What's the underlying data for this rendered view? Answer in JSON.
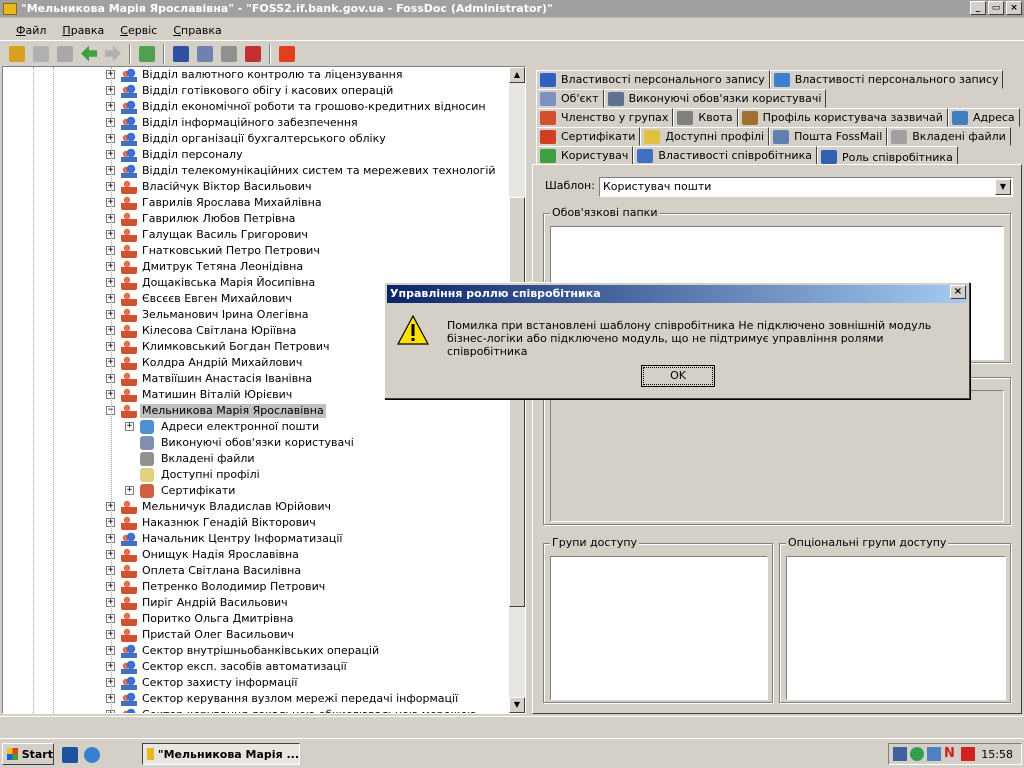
{
  "window": {
    "title": "\"Мельникова Марія Ярославівна\" - \"FOSS2.if.bank.gov.ua - FossDoc (Administrator)\""
  },
  "menu": [
    "Файл",
    "Правка",
    "Сервіс",
    "Справка"
  ],
  "tree": {
    "items": [
      {
        "label": "Відділ валютного контролю та ліцензування",
        "type": "dept",
        "level": 0
      },
      {
        "label": "Відділ готівкового обігу і касових операцій",
        "type": "dept",
        "level": 0
      },
      {
        "label": "Відділ економічної роботи та грошово-кредитних відносин",
        "type": "dept",
        "level": 0
      },
      {
        "label": "Відділ інформаційного забезпечення",
        "type": "dept",
        "level": 0
      },
      {
        "label": "Відділ організації бухгалтерського обліку",
        "type": "dept",
        "level": 0
      },
      {
        "label": "Відділ персоналу",
        "type": "dept",
        "level": 0
      },
      {
        "label": "Відділ телекомунікаційних систем та мережевих технологій",
        "type": "dept",
        "level": 0
      },
      {
        "label": "Власійчук Віктор Васильович",
        "type": "person",
        "level": 0
      },
      {
        "label": "Гаврилів Ярослава Михайлівна",
        "type": "person",
        "level": 0
      },
      {
        "label": "Гаврилюк Любов Петрівна",
        "type": "person",
        "level": 0
      },
      {
        "label": "Галущак Василь Григорович",
        "type": "person",
        "level": 0
      },
      {
        "label": "Гнатковський Петро Петрович",
        "type": "person",
        "level": 0
      },
      {
        "label": "Дмитрук Тетяна Леонідівна",
        "type": "person",
        "level": 0
      },
      {
        "label": "Дощаківська Марія Йосипівна",
        "type": "person",
        "level": 0
      },
      {
        "label": "Євсєєв Евген Михайлович",
        "type": "person",
        "level": 0
      },
      {
        "label": "Зельманович Ірина Олегівна",
        "type": "person",
        "level": 0
      },
      {
        "label": "Кілесова Світлана Юріївна",
        "type": "person",
        "level": 0
      },
      {
        "label": "Климковський Богдан Петрович",
        "type": "person",
        "level": 0
      },
      {
        "label": "Колдра Андрій Михайлович",
        "type": "person",
        "level": 0
      },
      {
        "label": "Матвіїшин Анастасія Іванівна",
        "type": "person",
        "level": 0
      },
      {
        "label": "Матишин Віталій Юрієвич",
        "type": "person",
        "level": 0
      },
      {
        "label": "Мельникова Марія Ярославівна",
        "type": "person",
        "level": 0,
        "expanded": true,
        "selected": true
      },
      {
        "label": "Адреси електронної пошти",
        "type": "mail",
        "level": 1,
        "expandable": true
      },
      {
        "label": "Виконуючі обов'язки користувачі",
        "type": "duty",
        "level": 1
      },
      {
        "label": "Вкладені файли",
        "type": "file",
        "level": 1
      },
      {
        "label": "Доступні профілі",
        "type": "profile",
        "level": 1
      },
      {
        "label": "Сертифікати",
        "type": "cert",
        "level": 1,
        "expandable": true
      },
      {
        "label": "Мельничук Владислав Юрійович",
        "type": "person",
        "level": 0
      },
      {
        "label": "Наказнюк Генадій Вікторович",
        "type": "person",
        "level": 0
      },
      {
        "label": "Начальник Центру Інформатизації",
        "type": "dept",
        "level": 0
      },
      {
        "label": "Онищук Надія Ярославівна",
        "type": "person",
        "level": 0
      },
      {
        "label": "Оплета Світлана Василівна",
        "type": "person",
        "level": 0
      },
      {
        "label": "Петренко Володимир Петрович",
        "type": "person",
        "level": 0
      },
      {
        "label": "Пиріг Андрій Васильович",
        "type": "person",
        "level": 0
      },
      {
        "label": "Поритко Ольга Дмитрівна",
        "type": "person",
        "level": 0
      },
      {
        "label": "Пристай Олег Васильович",
        "type": "person",
        "level": 0
      },
      {
        "label": "Сектор внутрішньобанківських операцій",
        "type": "dept",
        "level": 0
      },
      {
        "label": "Сектор експ. засобів автоматизації",
        "type": "dept",
        "level": 0
      },
      {
        "label": "Сектор захисту інформації",
        "type": "dept",
        "level": 0
      },
      {
        "label": "Сектор керування вузлом мережі передачі інформації",
        "type": "dept",
        "level": 0
      },
      {
        "label": "Сектор керування локальною обчислювальною мережею",
        "type": "dept",
        "level": 0
      }
    ]
  },
  "tabs": {
    "rows": [
      [
        {
          "label": "Властивості персонального запису",
          "icon": "#3060c0"
        },
        {
          "label": "Властивості персонального запису",
          "icon": "#4080d0"
        }
      ],
      [
        {
          "label": "Об'єкт",
          "icon": "#8090c0"
        },
        {
          "label": "Виконуючі обов'язки користувачі",
          "icon": "#607090"
        }
      ],
      [
        {
          "label": "Членство у групах",
          "icon": "#d05030"
        },
        {
          "label": "Квота",
          "icon": "#808080"
        },
        {
          "label": "Профіль користувача зазвичай",
          "icon": "#a07030"
        },
        {
          "label": "Адреса",
          "icon": "#4080c0"
        }
      ],
      [
        {
          "label": "Сертифікати",
          "icon": "#d04020"
        },
        {
          "label": "Доступні профілі",
          "icon": "#e0c040"
        },
        {
          "label": "Пошта FossMail",
          "icon": "#6080b0"
        },
        {
          "label": "Вкладені файли",
          "icon": "#a0a0a0"
        }
      ],
      [
        {
          "label": "Користувач",
          "icon": "#40a040"
        },
        {
          "label": "Властивості співробітника",
          "icon": "#4070c0"
        },
        {
          "label": "Роль співробітника",
          "icon": "#3060b0",
          "active": true
        }
      ]
    ]
  },
  "role_tab": {
    "template_label": "Шаблон:",
    "template_value": "Користувач пошти",
    "mandatory_folders": "Обов'язкові папки",
    "access_groups": "Групи доступу",
    "optional_groups": "Опціональні групи доступу"
  },
  "dialog": {
    "title": "Управління роллю співробітника",
    "message": "Помилка при встановлені шаблону співробітника Не підключено зовнішній модуль бізнес-логіки або підключено модуль, що не підтримує управління ролями співробітника",
    "ok": "OK"
  },
  "taskbar": {
    "start": "Start",
    "task": "\"Мельникова Марія ...",
    "clock": "15:58"
  }
}
